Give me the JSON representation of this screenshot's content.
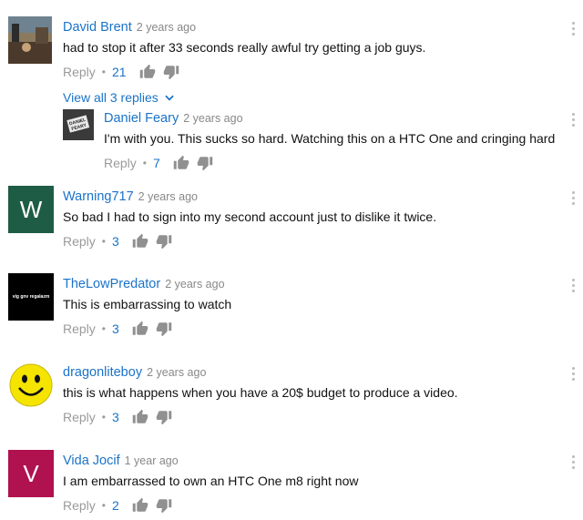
{
  "ui": {
    "reply_label": "Reply",
    "dot": "•"
  },
  "comments": [
    {
      "author": "David Brent",
      "time": "2 years ago",
      "text": "had to stop it after 33 seconds really awful try getting a job guys.",
      "likes": "21",
      "view_replies": "View all 3 replies",
      "avatar_icon": "landscape-photo-avatar"
    },
    {
      "author": "Daniel Feary",
      "time": "2 years ago",
      "text": "I'm with you. This sucks so hard. Watching this on a HTC One and cringing hard",
      "likes": "7",
      "avatar_text": "DANIEL\nFEARY",
      "avatar_color": "#3a3a3a"
    },
    {
      "author": "Warning717",
      "time": "2 years ago",
      "text": "So bad I had to sign into my second account just to dislike it twice.",
      "likes": "3",
      "avatar_letter": "W",
      "avatar_color": "#1f5c45"
    },
    {
      "author": "TheLowPredator",
      "time": "2 years ago",
      "text": "This is embarrassing to watch",
      "likes": "3",
      "avatar_text": "vig gnv regalazm",
      "avatar_color": "#000000"
    },
    {
      "author": "dragonliteboy",
      "time": "2 years ago",
      "text": "this is what happens when you have a 20$ budget to produce a video.",
      "likes": "3",
      "avatar_icon": "smiley-face-avatar",
      "avatar_color": "#f5e400"
    },
    {
      "author": "Vida Jocif",
      "time": "1 year ago",
      "text": "I am embarrassed to own an HTC One m8 right now",
      "likes": "2",
      "avatar_letter": "V",
      "avatar_color": "#b0114f"
    }
  ]
}
